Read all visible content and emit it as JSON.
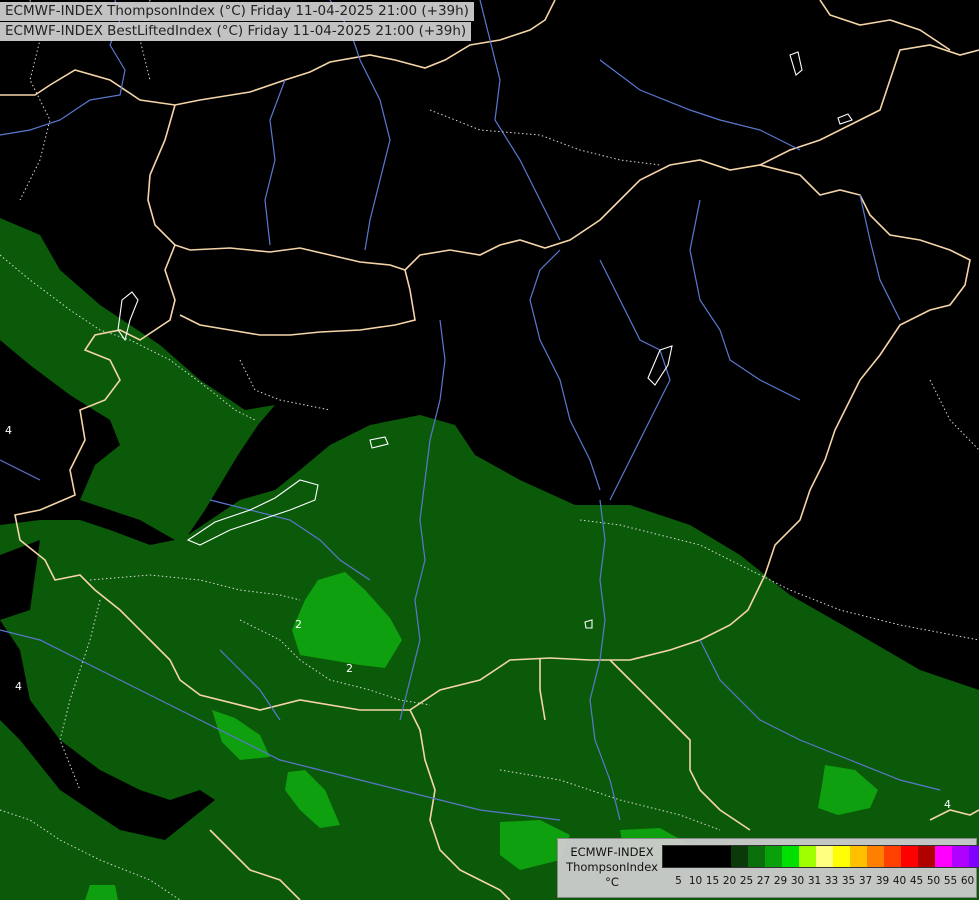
{
  "titles": {
    "line1": "ECMWF-INDEX ThompsonIndex (°C) Friday 11-04-2025 21:00 (+39h)",
    "line2": "ECMWF-INDEX BestLiftedIndex (°C) Friday 11-04-2025 21:00 (+39h)"
  },
  "legend": {
    "line1": "ECMWF-INDEX",
    "line2": "ThompsonIndex",
    "unit": "°C",
    "ticks": [
      "5",
      "10",
      "15",
      "20",
      "25",
      "27",
      "29",
      "30",
      "31",
      "33",
      "35",
      "37",
      "39",
      "40",
      "45",
      "50",
      "55",
      "60"
    ],
    "colors": [
      "#000000",
      "#000000",
      "#000000",
      "#000000",
      "#0a3a0a",
      "#0a6e0a",
      "#0aa00a",
      "#00e000",
      "#a0ff00",
      "#ffff80",
      "#ffff00",
      "#ffc000",
      "#ff8000",
      "#ff4000",
      "#ff0000",
      "#b00000",
      "#ff00ff",
      "#b000ff",
      "#8000ff",
      "#0000ff"
    ]
  },
  "contour_labels": [
    "2",
    "2",
    "4",
    "4",
    "4"
  ],
  "colors": {
    "background": "#000000",
    "field_dark_green": "#0a5a0a",
    "field_mid_green": "#0a9a0a",
    "field_bright_green": "#0fbf0f",
    "border": "#f5d5a8",
    "river": "#5a78d0",
    "contour": "#d8d8d8"
  }
}
